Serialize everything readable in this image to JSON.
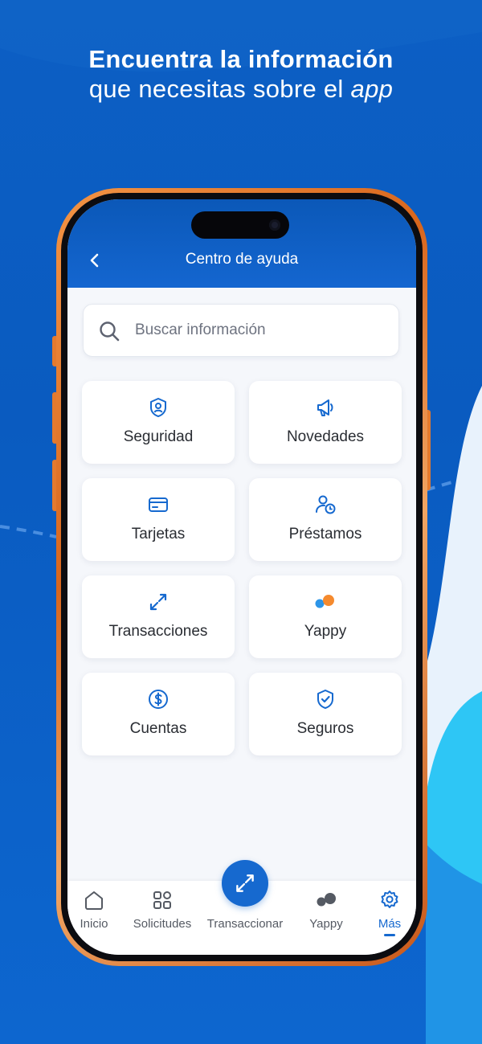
{
  "promo": {
    "headline_bold": "Encuentra la información",
    "headline_rest": "que necesitas sobre el ",
    "headline_italic": "app"
  },
  "header": {
    "title": "Centro de ayuda"
  },
  "search": {
    "placeholder": "Buscar información"
  },
  "categories": [
    {
      "label": "Seguridad",
      "icon": "shield-user-icon"
    },
    {
      "label": "Novedades",
      "icon": "megaphone-icon"
    },
    {
      "label": "Tarjetas",
      "icon": "credit-card-icon"
    },
    {
      "label": "Préstamos",
      "icon": "user-clock-icon"
    },
    {
      "label": "Transacciones",
      "icon": "transfer-arrows-icon"
    },
    {
      "label": "Yappy",
      "icon": "yappy-logo-icon"
    },
    {
      "label": "Cuentas",
      "icon": "dollar-circle-icon"
    },
    {
      "label": "Seguros",
      "icon": "shield-check-icon"
    }
  ],
  "tabbar": {
    "items": [
      {
        "label": "Inicio",
        "icon": "home-icon"
      },
      {
        "label": "Solicitudes",
        "icon": "grid-icon"
      },
      {
        "label": "Transaccionar",
        "icon": "transfer-arrows-icon"
      },
      {
        "label": "Yappy",
        "icon": "yappy-logo-icon"
      },
      {
        "label": "Más",
        "icon": "gear-icon"
      }
    ],
    "active": "Más"
  },
  "colors": {
    "brand_blue": "#1669cf",
    "background_blue": "#0c5fc4",
    "phone_frame": "#e47a2e",
    "yappy_orange": "#f58a2e",
    "yappy_blue": "#2d95e8"
  }
}
